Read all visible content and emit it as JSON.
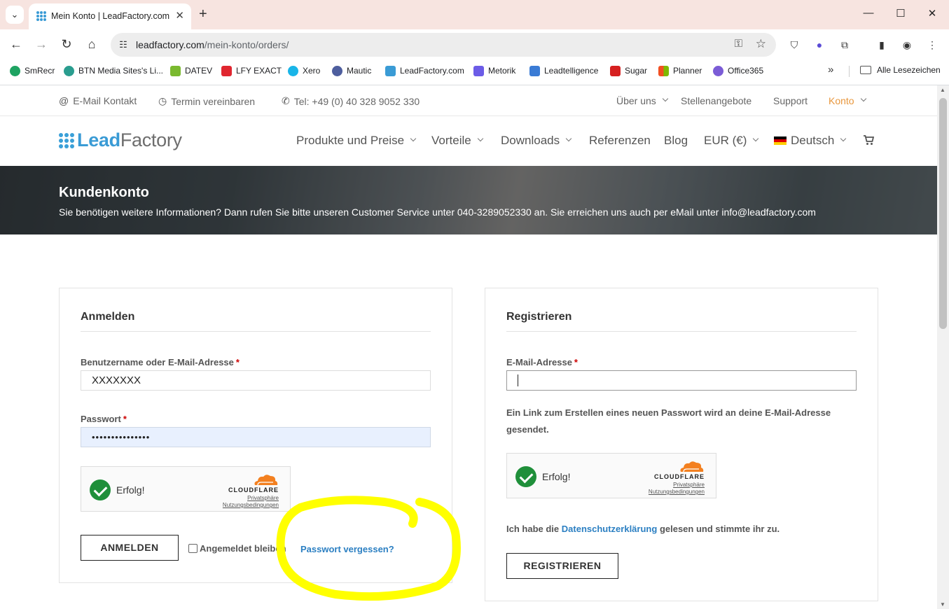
{
  "browser": {
    "tab_title": "Mein Konto | LeadFactory.com",
    "url_host": "leadfactory.com",
    "url_path": "/mein-konto/orders/",
    "bookmarks": [
      {
        "label": "SmRecr",
        "color": "#1ea362"
      },
      {
        "label": "BTN Media Sites's Li...",
        "color": "#2a9d8f"
      },
      {
        "label": "DATEV",
        "color": "#7ab92f"
      },
      {
        "label": "LFY EXACT",
        "color": "#e0262f"
      },
      {
        "label": "Xero",
        "color": "#19b5e8"
      },
      {
        "label": "Mautic",
        "color": "#4e5e9e"
      },
      {
        "label": "LeadFactory.com",
        "color": "#3a9bd5"
      },
      {
        "label": "Metorik",
        "color": "#6c5ce7"
      },
      {
        "label": "Leadtelligence",
        "color": "#3a7bd5"
      },
      {
        "label": "Sugar",
        "color": "#d62020"
      },
      {
        "label": "Planner",
        "color": "#f25022"
      },
      {
        "label": "Office365",
        "color": "#7b5cd6"
      }
    ],
    "all_bookmarks": "Alle Lesezeichen"
  },
  "topbar": {
    "email": "E-Mail Kontakt",
    "termin": "Termin vereinbaren",
    "tel": "Tel: +49 (0) 40 328 9052 330",
    "ueber": "Über uns",
    "jobs": "Stellenangebote",
    "support": "Support",
    "konto": "Konto"
  },
  "logo": {
    "dark": "Lead",
    "light": "Factory"
  },
  "nav": {
    "produkte": "Produkte und Preise",
    "vorteile": "Vorteile",
    "downloads": "Downloads",
    "referenzen": "Referenzen",
    "blog": "Blog",
    "currency": "EUR (€)",
    "language": "Deutsch"
  },
  "hero": {
    "title": "Kundenkonto",
    "text": "Sie benötigen weitere Informationen? Dann rufen Sie bitte unseren Customer Service unter 040-3289052330 an. Sie erreichen uns auch per eMail unter info@leadfactory.com"
  },
  "login": {
    "title": "Anmelden",
    "username_label": "Benutzername oder E-Mail-Adresse",
    "username_value": "XXXXXXX",
    "password_label": "Passwort",
    "password_value": "•••••••••••••••",
    "captcha_ok": "Erfolg!",
    "submit": "ANMELDEN",
    "remember": "Angemeldet bleiben",
    "forgot": "Passwort vergessen?"
  },
  "register": {
    "title": "Registrieren",
    "email_label": "E-Mail-Adresse",
    "note": "Ein Link zum Erstellen eines neuen Passwort wird an deine E-Mail-Adresse gesendet.",
    "captcha_ok": "Erfolg!",
    "privacy_pre": "Ich habe die",
    "privacy_link": "Datenschutzerklärung",
    "privacy_post": "gelesen und stimmte ihr zu.",
    "submit": "REGISTRIEREN"
  },
  "cloudflare": {
    "brand": "CLOUDFLARE",
    "privacy": "Privatsphäre",
    "terms": "Nutzungsbedingungen"
  },
  "required_mark": "*",
  "colors": {
    "accent": "#3a9bd5",
    "konto": "#e8963b",
    "highlight": "#ffff00",
    "success": "#1f8f3a"
  }
}
